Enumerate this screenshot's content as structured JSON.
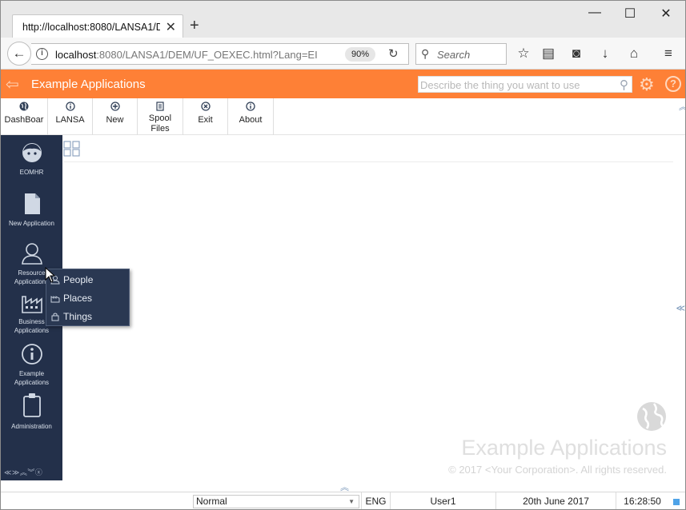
{
  "browser": {
    "tab_title": "http://localhost:8080/LANSA1/D",
    "url_host": "localhost",
    "url_rest": ":8080/LANSA1/DEM/UF_OEXEC.html?Lang=EI",
    "zoom": "90%",
    "search_placeholder": "Search"
  },
  "app": {
    "title": "Example Applications",
    "search_placeholder": "Describe the thing you want to use",
    "accent_color": "#fe8036",
    "nav_color": "#23304a"
  },
  "toolbar": {
    "items": [
      {
        "label": "DashBoar",
        "icon": "globe-icon"
      },
      {
        "label": "LANSA",
        "icon": "info-circle-icon"
      },
      {
        "label": "New",
        "icon": "plus-circle-icon"
      },
      {
        "label": "Spool Files",
        "label_line1": "Spool",
        "label_line2": "Files",
        "icon": "document-icon"
      },
      {
        "label": "Exit",
        "icon": "close-circle-icon"
      },
      {
        "label": "About",
        "icon": "info-circle-icon"
      }
    ]
  },
  "sidenav": {
    "items": [
      {
        "label": "EOMHR",
        "icon": "face-icon"
      },
      {
        "label": "New Application",
        "icon": "page-icon"
      },
      {
        "label": "Resource Applications",
        "line1": "Resource",
        "line2": "Applications",
        "icon": "person-icon"
      },
      {
        "label": "Business Applications",
        "line1": "Business",
        "line2": "Applications",
        "icon": "factory-icon"
      },
      {
        "label": "Example Applications",
        "line1": "Example",
        "line2": "Applications",
        "icon": "info-icon"
      },
      {
        "label": "Administration",
        "icon": "clipboard-icon"
      }
    ]
  },
  "popup": {
    "items": [
      {
        "label": "People",
        "icon": "people-icon"
      },
      {
        "label": "Places",
        "icon": "places-icon"
      },
      {
        "label": "Things",
        "icon": "things-icon"
      }
    ]
  },
  "branding": {
    "title": "Example Applications",
    "copyright": "© 2017 <Your Corporation>. All rights reserved."
  },
  "status": {
    "mode": "Normal",
    "language": "ENG",
    "user": "User1",
    "date": "20th June 2017",
    "time": "16:28:50"
  }
}
